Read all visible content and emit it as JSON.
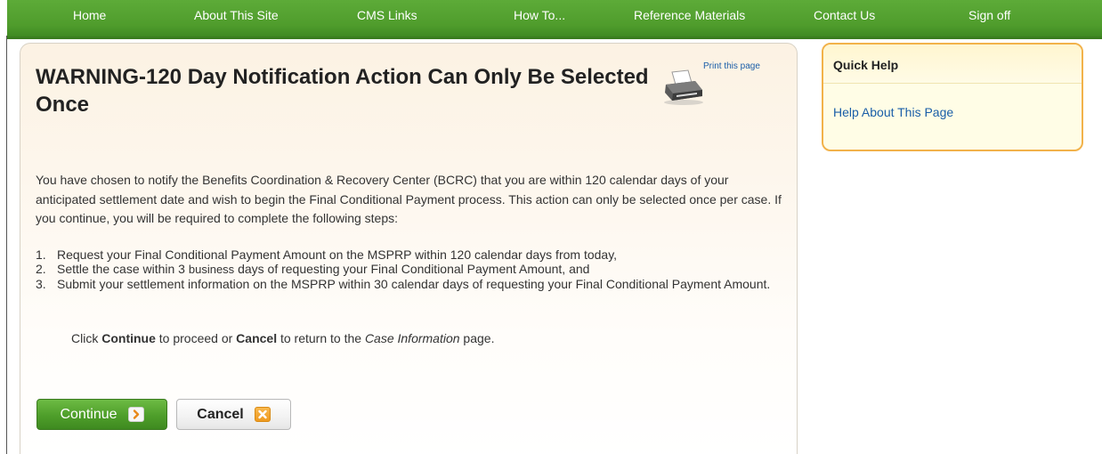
{
  "nav": {
    "items": [
      "Home",
      "About This Site",
      "CMS Links",
      "How To...",
      "Reference Materials",
      "Contact Us",
      "Sign off"
    ]
  },
  "page": {
    "title": "WARNING-120 Day Notification Action Can Only Be Selected Once",
    "print_link": "Print this page",
    "paragraph": "You have chosen to notify the Benefits Coordination & Recovery Center (BCRC) that you are within 120 calendar days of your anticipated settlement date and wish to begin the Final Conditional Payment process. This action can only be selected once per case. If you continue, you will be required to complete the following steps:",
    "steps": [
      {
        "num": "1.",
        "text": "Request your Final Conditional Payment Amount on the MSPRP within 120 calendar days from today,"
      },
      {
        "num": "2.",
        "text_before": "Settle the case within 3",
        "text_small": "business",
        "text_after": "days of requesting your Final Conditional Payment Amount, and"
      },
      {
        "num": "3.",
        "text": "Submit your settlement information on the MSPRP within 30 calendar days of requesting your Final Conditional Payment Amount."
      }
    ],
    "instruction": {
      "part1": "Click ",
      "continue_word": "Continue",
      "part2": " to proceed or ",
      "cancel_word": "Cancel",
      "part3": " to return to the ",
      "page_name": "Case Information",
      "part4": " page."
    }
  },
  "buttons": {
    "continue_label": "Continue",
    "cancel_label": "Cancel"
  },
  "quick_help": {
    "title": "Quick Help",
    "link": "Help About This Page"
  },
  "icons": {
    "print": "printer-icon",
    "continue": "chevron-right-icon",
    "cancel": "close-x-icon"
  },
  "colors": {
    "nav_green": "#4f9c2c",
    "link_blue": "#1a5ea8",
    "quick_help_border": "#f2b24a",
    "cancel_icon_orange": "#ef9a1f"
  }
}
